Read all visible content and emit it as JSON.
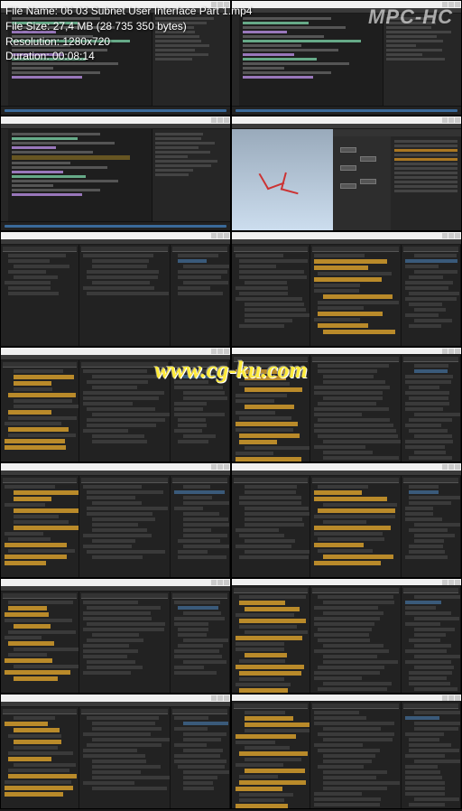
{
  "overlay": {
    "filename_label": "File Name: ",
    "filename": "06 03 Subnet User Interface Part 1.mp4",
    "filesize_label": "File Size: ",
    "filesize": "27,4 MB (28 735 350 bytes)",
    "resolution_label": "Resolution: ",
    "resolution": "1280x720",
    "duration_label": "Duration: ",
    "duration": "00:08:14"
  },
  "player_name": "MPC-HC",
  "watermark": "www.cg-ku.com",
  "thumbnails": [
    {
      "kind": "code"
    },
    {
      "kind": "code"
    },
    {
      "kind": "code_sel"
    },
    {
      "kind": "viewport_nodes"
    },
    {
      "kind": "params_sparse"
    },
    {
      "kind": "params_hl"
    },
    {
      "kind": "params_hl"
    },
    {
      "kind": "params_dense"
    },
    {
      "kind": "params_hl"
    },
    {
      "kind": "params_hl"
    },
    {
      "kind": "params_hl"
    },
    {
      "kind": "params_dense"
    },
    {
      "kind": "params_hl"
    },
    {
      "kind": "params_dense"
    }
  ]
}
